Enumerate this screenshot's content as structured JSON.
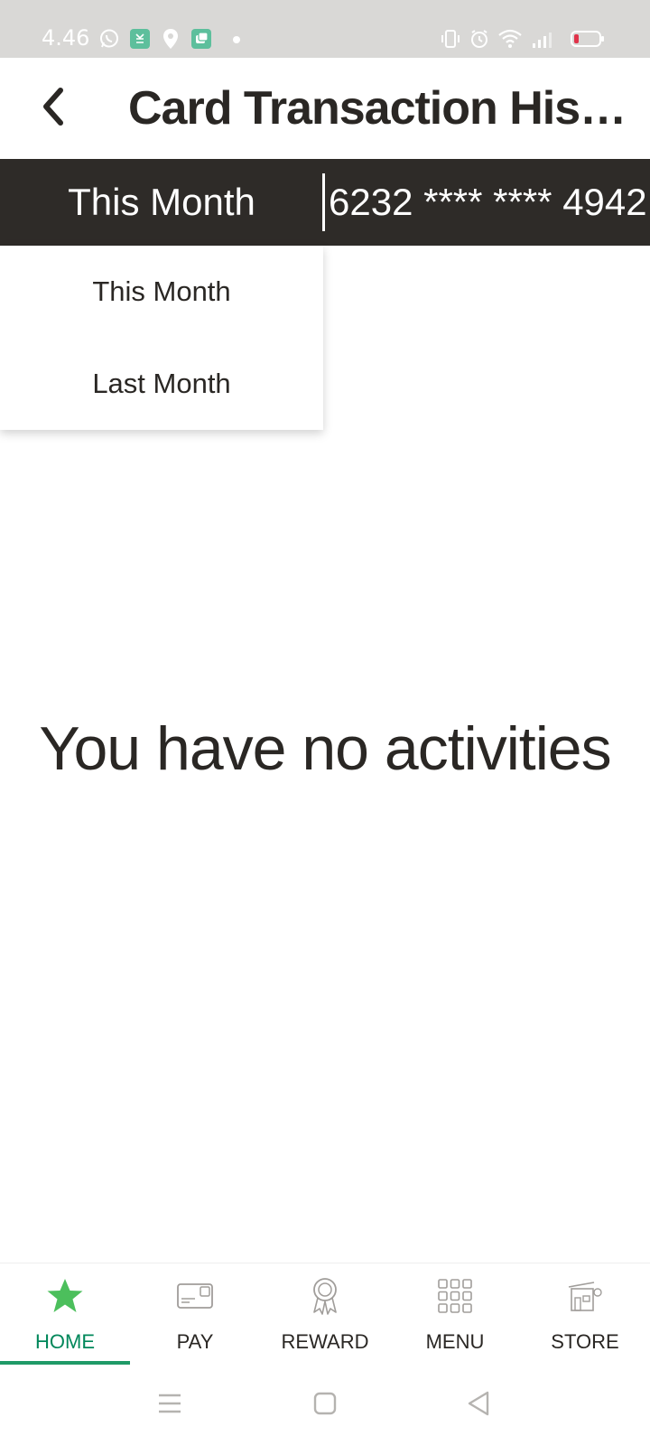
{
  "status_bar": {
    "time": "4.46",
    "icons": [
      "whatsapp-icon",
      "shop-app-icon",
      "location-pin-icon",
      "chat-app-icon",
      "vibrate-icon",
      "alarm-icon",
      "wifi-icon",
      "signal-icon",
      "battery-low-icon"
    ]
  },
  "header": {
    "title": "Card Transaction History"
  },
  "filter": {
    "selected_period": "This Month",
    "card_number": "6232 **** **** 4942"
  },
  "dropdown": {
    "options": [
      "This Month",
      "Last Month"
    ]
  },
  "empty_state": {
    "message": "You have no activities"
  },
  "bottom_nav": {
    "items": [
      {
        "label": "HOME",
        "icon": "star-icon",
        "active": true
      },
      {
        "label": "PAY",
        "icon": "card-icon",
        "active": false
      },
      {
        "label": "REWARD",
        "icon": "ribbon-icon",
        "active": false
      },
      {
        "label": "MENU",
        "icon": "grid-icon",
        "active": false
      },
      {
        "label": "STORE",
        "icon": "store-icon",
        "active": false
      }
    ]
  },
  "colors": {
    "accent": "#00875a",
    "star": "#4cbf5c",
    "filter_bar": "#2e2b28",
    "text": "#2a2724"
  }
}
